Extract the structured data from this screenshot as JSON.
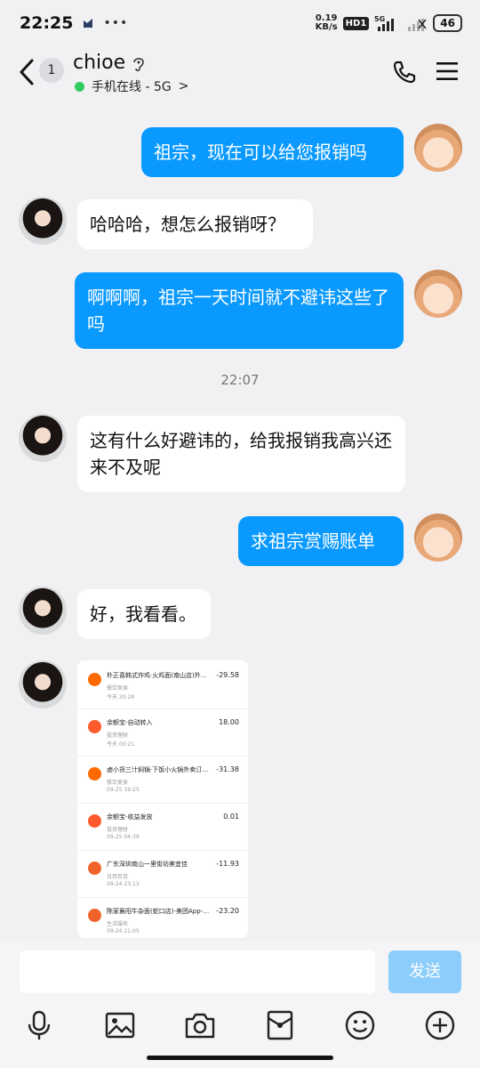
{
  "status_bar": {
    "time": "22:25",
    "dots": "•••",
    "speed_value": "0.19",
    "speed_unit": "KB/s",
    "hd": "HD1",
    "net": "5G",
    "battery": "46"
  },
  "header": {
    "badge_count": "1",
    "contact_name": "chioe",
    "online_status": "手机在线 - 5G",
    "online_chevron": ">"
  },
  "messages": [
    {
      "sender": "me",
      "text": "祖宗，现在可以给您报销吗"
    },
    {
      "sender": "her",
      "text": "哈哈哈，想怎么报销呀？"
    },
    {
      "sender": "me",
      "text": "啊啊啊，祖宗一天时间就不避讳这些了吗"
    },
    {
      "sender": "her",
      "text": "这有什么好避讳的，给我报销我高兴还来不及呢"
    },
    {
      "sender": "me",
      "text": "求祖宗赏赐账单"
    },
    {
      "sender": "her",
      "text": "好，我看看。"
    }
  ],
  "timestamp": "22:07",
  "bill_screenshot": {
    "transactions": [
      {
        "title": "朴正喜韩式炸鸡·火鸡面(南山店)外…",
        "category": "餐饮美食",
        "time": "今天 20:28",
        "amount": "-29.58",
        "icon_color": "#ff6a00"
      },
      {
        "title": "余额宝-自动转入",
        "category": "投资理财",
        "time": "今天 00:21",
        "amount": "18.00",
        "icon_color": "#ff5a2b"
      },
      {
        "title": "卤小货三汁焖锅·下饭小火锅外卖订…",
        "category": "餐饮美食",
        "time": "09-25 19:25",
        "amount": "-31.38",
        "icon_color": "#ff6a00"
      },
      {
        "title": "余额宝-收益发放",
        "category": "投资理财",
        "time": "09-25 04:39",
        "amount": "0.01",
        "icon_color": "#ff5a2b"
      },
      {
        "title": "广东深圳南山一里街坊美宜佳",
        "category": "日用百货",
        "time": "09-24 23:13",
        "amount": "-11.93",
        "icon_color": "#f0642c"
      },
      {
        "title": "陈家襄阳牛杂面(蛇口店)-美团App-…",
        "category": "生活服务",
        "time": "09-24 21:05",
        "amount": "-23.20",
        "icon_color": "#f0642c"
      }
    ]
  },
  "input": {
    "placeholder": "",
    "send_label": "发送"
  },
  "toolbar": [
    "mic-icon",
    "image-icon",
    "camera-icon",
    "red-packet-icon",
    "emoji-icon",
    "plus-icon"
  ],
  "colors": {
    "accent": "#0a99ff",
    "send_disabled": "#8ccdfb",
    "online_dot": "#2ecc5e",
    "background": "#f1f1f4"
  }
}
